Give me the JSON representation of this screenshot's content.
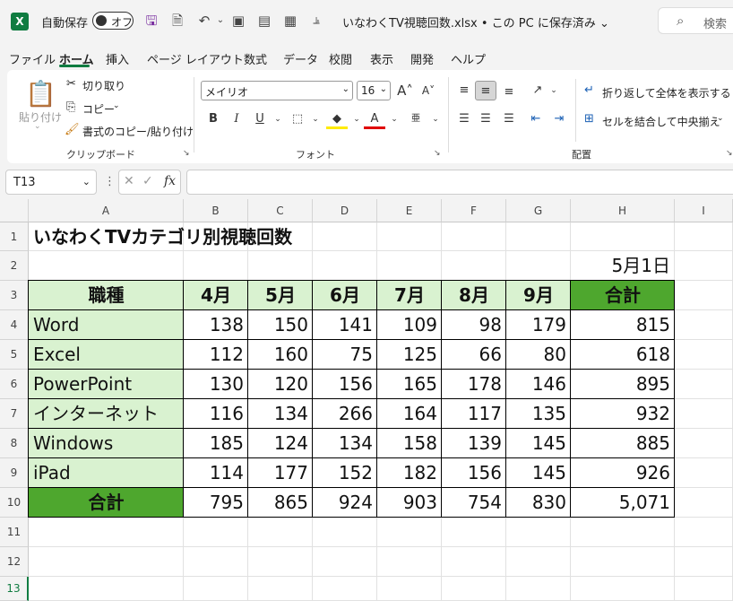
{
  "titlebar": {
    "app_logo": "X",
    "autosave_label": "自動保存",
    "autosave_state": "オフ",
    "doc_title": "いなわくTV視聴回数.xlsx • この PC に保存済み ⌄",
    "search_placeholder": "検索"
  },
  "menu": [
    "ファイル",
    "ホーム",
    "挿入",
    "ページ レイアウト",
    "数式",
    "データ",
    "校閲",
    "表示",
    "開発",
    "ヘルプ"
  ],
  "ribbon": {
    "paste": "貼り付け",
    "cut": "切り取り",
    "copy": "コピー",
    "format_painter": "書式のコピー/貼り付け",
    "clipboard_group": "クリップボード",
    "font_name": "メイリオ",
    "font_size": "16",
    "font_group": "フォント",
    "bold": "B",
    "italic": "I",
    "underline": "U",
    "wrap_text": "折り返して全体を表示する",
    "merge_center": "セルを結合して中央揃え",
    "alignment_group": "配置"
  },
  "formula_bar": {
    "name_box": "T13",
    "fx": "fx",
    "formula": ""
  },
  "columns": [
    "A",
    "B",
    "C",
    "D",
    "E",
    "F",
    "G",
    "H",
    "I"
  ],
  "rows": [
    "1",
    "2",
    "3",
    "4",
    "5",
    "6",
    "7",
    "8",
    "9",
    "10",
    "11",
    "12",
    "13"
  ],
  "sheet": {
    "title": "いなわくTVカテゴリ別視聴回数",
    "date": "5月1日",
    "header": [
      "職種",
      "4月",
      "5月",
      "6月",
      "7月",
      "8月",
      "9月",
      "合計"
    ],
    "body": [
      [
        "Word",
        "138",
        "150",
        "141",
        "109",
        "98",
        "179",
        "815"
      ],
      [
        "Excel",
        "112",
        "160",
        "75",
        "125",
        "66",
        "80",
        "618"
      ],
      [
        "PowerPoint",
        "130",
        "120",
        "156",
        "165",
        "178",
        "146",
        "895"
      ],
      [
        "インターネット",
        "116",
        "134",
        "266",
        "164",
        "117",
        "135",
        "932"
      ],
      [
        "Windows",
        "185",
        "124",
        "134",
        "158",
        "139",
        "145",
        "885"
      ],
      [
        "iPad",
        "114",
        "177",
        "152",
        "182",
        "156",
        "145",
        "926"
      ]
    ],
    "total": [
      "合計",
      "795",
      "865",
      "924",
      "903",
      "754",
      "830",
      "5,071"
    ]
  },
  "colors": {
    "light_green": "#d9f2d0",
    "dark_green": "#4ea72e",
    "excel_green": "#107c41"
  }
}
